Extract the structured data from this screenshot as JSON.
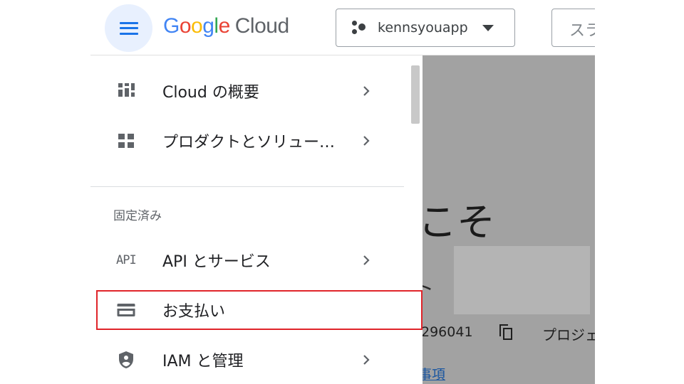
{
  "header": {
    "menu_icon": "hamburger-menu-icon",
    "logo": {
      "google_letters": [
        "G",
        "o",
        "o",
        "g",
        "l",
        "e"
      ],
      "cloud_word": "Cloud"
    },
    "project_picker": {
      "icon": "project-dots-icon",
      "name": "kennsyouapp",
      "caret": "caret-down-icon"
    },
    "search_partial": "スラ"
  },
  "drawer": {
    "items_top": [
      {
        "icon": "dashboard-icon",
        "label": "Cloud の概要",
        "has_submenu": true
      },
      {
        "icon": "products-grid-icon",
        "label": "プロダクトとソリュー…",
        "has_submenu": true
      }
    ],
    "pinned_title": "固定済み",
    "items_pinned": [
      {
        "icon": "api-icon",
        "icon_text": "API",
        "label": "API とサービス",
        "has_submenu": true
      },
      {
        "icon": "billing-card-icon",
        "label": "お支払い",
        "has_submenu": false,
        "highlighted": true
      },
      {
        "icon": "iam-shield-icon",
        "label": "IAM と管理",
        "has_submenu": true
      }
    ]
  },
  "main": {
    "heading_partial": "こそ",
    "subtext_partial": "ト",
    "project_number_partial": "296041",
    "copy_icon": "copy-icon",
    "project_label_partial": "プロジェ",
    "link_partial": "事項"
  },
  "colors": {
    "accent": "#1a73e8",
    "highlight_border": "#e0242a",
    "overlay": "#a2a2a2"
  }
}
